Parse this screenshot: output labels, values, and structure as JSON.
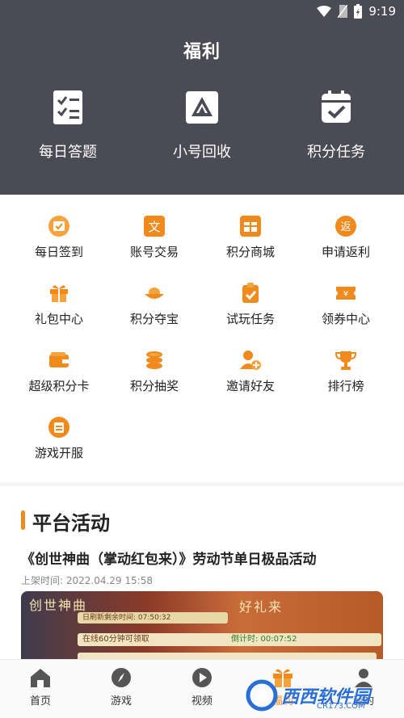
{
  "status": {
    "time": "9:19"
  },
  "header": {
    "title": "福利"
  },
  "top_features": [
    {
      "label": "每日答题",
      "icon": "checklist-icon"
    },
    {
      "label": "小号回收",
      "icon": "recycle-icon"
    },
    {
      "label": "积分任务",
      "icon": "calendar-check-icon"
    }
  ],
  "grid": [
    {
      "label": "每日签到",
      "icon": "calendar-sign-icon"
    },
    {
      "label": "账号交易",
      "icon": "trade-icon"
    },
    {
      "label": "积分商城",
      "icon": "shop-icon"
    },
    {
      "label": "申请返利",
      "icon": "rebate-icon"
    },
    {
      "label": "礼包中心",
      "icon": "gift-icon"
    },
    {
      "label": "积分夺宝",
      "icon": "treasure-icon"
    },
    {
      "label": "试玩任务",
      "icon": "clipboard-check-icon"
    },
    {
      "label": "领券中心",
      "icon": "coupon-icon"
    },
    {
      "label": "超级积分卡",
      "icon": "wallet-icon"
    },
    {
      "label": "积分抽奖",
      "icon": "coins-icon"
    },
    {
      "label": "邀请好友",
      "icon": "add-user-icon"
    },
    {
      "label": "排行榜",
      "icon": "trophy-icon"
    },
    {
      "label": "游戏开服",
      "icon": "server-icon"
    }
  ],
  "activity": {
    "section_title": "平台活动",
    "headline": "《创世神曲（掌动红包来）》劳动节单日极品活动",
    "time": "上架时间: 2022.04.29 15:58",
    "banner": {
      "title_left": "创世神曲",
      "title_right": "好礼来",
      "row1": "日刷新剩余时间: 07:50:32",
      "row2": "在线60分钟可领取",
      "row2_right": "倒计时: 00:07:52"
    }
  },
  "tabs": [
    {
      "label": "首页",
      "icon": "home-icon"
    },
    {
      "label": "游戏",
      "icon": "compass-icon"
    },
    {
      "label": "视频",
      "icon": "play-icon"
    },
    {
      "label": "福利",
      "icon": "gift-icon"
    },
    {
      "label": "我的",
      "icon": "user-icon"
    }
  ],
  "watermark": {
    "text": "西西软件园",
    "sub": "CR173.COM"
  },
  "colors": {
    "header_bg": "#4b4b55",
    "accent": "#f08a1d"
  }
}
